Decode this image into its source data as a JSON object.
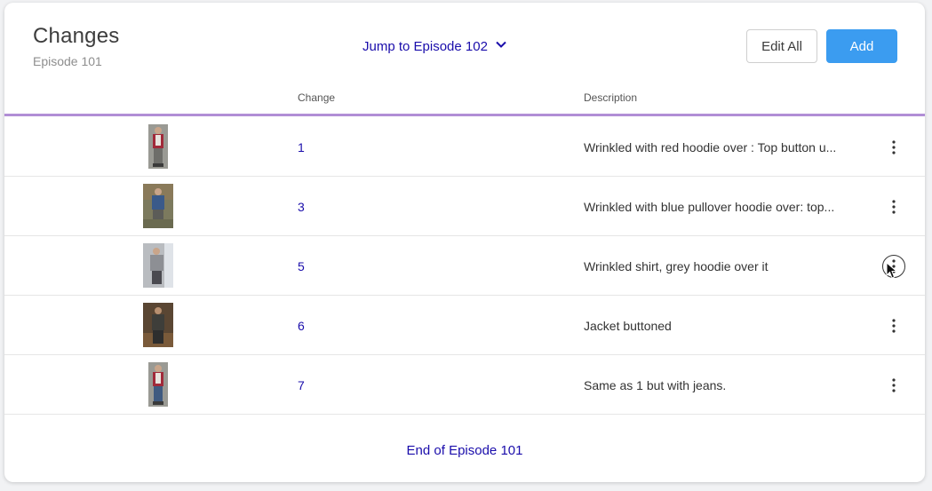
{
  "header": {
    "title": "Changes",
    "subtitle": "Episode 101",
    "jump_label": "Jump to Episode 102",
    "edit_all_label": "Edit All",
    "add_label": "Add"
  },
  "table": {
    "columns": [
      "",
      "Change",
      "Description"
    ],
    "rows": [
      {
        "change": "1",
        "description": "Wrinkled with red hoodie over : Top button u...",
        "thumb": "red-hoodie-photo"
      },
      {
        "change": "3",
        "description": "Wrinkled with blue pullover hoodie over: top...",
        "thumb": "blue-hoodie-photo"
      },
      {
        "change": "5",
        "description": "Wrinkled shirt, grey hoodie over it",
        "thumb": "grey-hoodie-photo"
      },
      {
        "change": "6",
        "description": "Jacket buttoned",
        "thumb": "jacket-photo"
      },
      {
        "change": "7",
        "description": "Same as 1 but with jeans.",
        "thumb": "red-hoodie-jeans-photo"
      }
    ]
  },
  "footer": {
    "end_label": "End of Episode 101"
  },
  "colors": {
    "accent_line": "#b18ed6",
    "link": "#1a0dab",
    "primary_button": "#3b9cf0"
  }
}
